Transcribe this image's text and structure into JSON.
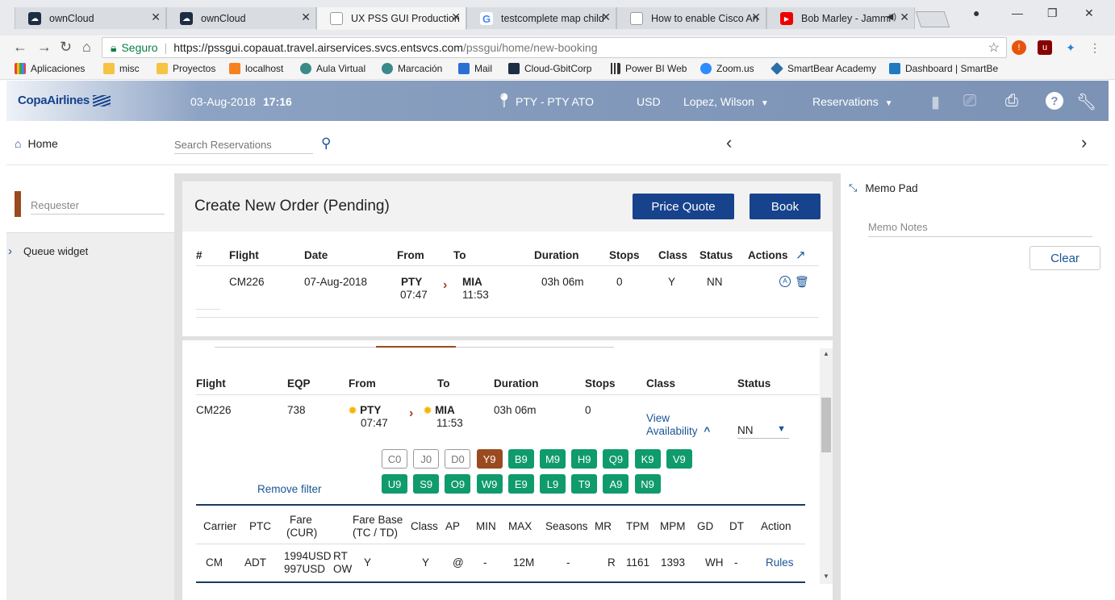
{
  "browser": {
    "tabs": [
      {
        "title": "ownCloud"
      },
      {
        "title": "ownCloud"
      },
      {
        "title": "UX PSS GUI Production"
      },
      {
        "title": "testcomplete map child"
      },
      {
        "title": "How to enable Cisco An"
      },
      {
        "title": "Bob Marley - Jammi"
      }
    ],
    "security_label": "Seguro",
    "url_host": "https://pssgui.copauat.travel.airservices.svcs.entsvcs.com",
    "url_path": "/pssgui/home/new-booking",
    "bookmarks": [
      "Aplicaciones",
      "misc",
      "Proyectos",
      "localhost",
      "Aula Virtual",
      "Marcación",
      "Mail",
      "Cloud-GbitCorp",
      "Power BI Web",
      "Zoom.us",
      "SmartBear Academy",
      "Dashboard | SmartBe"
    ]
  },
  "header": {
    "logo": "CopaAirlines",
    "date": "03-Aug-2018",
    "time": "17:16",
    "location": "PTY - PTY ATO",
    "currency": "USD",
    "user": "Lopez, Wilson",
    "menu": "Reservations"
  },
  "subheader": {
    "home_label": "Home",
    "search_placeholder": "Search Reservations"
  },
  "left": {
    "requester_placeholder": "Requester",
    "queue_label": "Queue widget"
  },
  "order": {
    "title": "Create New Order (Pending)",
    "price_quote": "Price Quote",
    "book": "Book",
    "columns": [
      "#",
      "Flight",
      "Date",
      "From",
      "To",
      "Duration",
      "Stops",
      "Class",
      "Status",
      "Actions"
    ],
    "row": {
      "flight": "CM226",
      "date": "07-Aug-2018",
      "from_code": "PTY",
      "from_time": "07:47",
      "to_code": "MIA",
      "to_time": "11:53",
      "duration": "03h 06m",
      "stops": "0",
      "class": "Y",
      "status": "NN"
    }
  },
  "segment": {
    "columns": [
      "Flight",
      "EQP",
      "From",
      "To",
      "Duration",
      "Stops",
      "Class",
      "Status"
    ],
    "row": {
      "flight": "CM226",
      "eqp": "738",
      "from_code": "PTY",
      "from_time": "07:47",
      "to_code": "MIA",
      "to_time": "11:53",
      "duration": "03h 06m",
      "stops": "0",
      "view_avail_1": "View",
      "view_avail_2": "Availability",
      "status": "NN"
    },
    "classes_row1": [
      "C0",
      "J0",
      "D0",
      "Y9",
      "B9",
      "M9",
      "H9",
      "Q9",
      "K9",
      "V9"
    ],
    "classes_row2": [
      "U9",
      "S9",
      "O9",
      "W9",
      "E9",
      "L9",
      "T9",
      "A9",
      "N9"
    ],
    "remove_filter": "Remove filter",
    "fare_columns": {
      "carrier": "Carrier",
      "ptc": "PTC",
      "fare": "Fare",
      "fare_cur": "(CUR)",
      "farebase": "Fare Base",
      "farebase_sub": "(TC / TD)",
      "class": "Class",
      "ap": "AP",
      "min": "MIN",
      "max": "MAX",
      "seasons": "Seasons",
      "mr": "MR",
      "tpm": "TPM",
      "mpm": "MPM",
      "gd": "GD",
      "dt": "DT",
      "action": "Action"
    },
    "fare_row": {
      "carrier": "CM",
      "ptc": "ADT",
      "fare1": "1994USD",
      "fare1_type": "RT",
      "fare2": "997USD",
      "fare2_type": "OW",
      "farebase": "Y",
      "class": "Y",
      "ap": "@",
      "min": "-",
      "max": "12M",
      "seasons": "-",
      "mr": "R",
      "tpm": "1161",
      "mpm": "1393",
      "gd": "WH",
      "dt": "-",
      "action": "Rules"
    }
  },
  "memo": {
    "title": "Memo Pad",
    "placeholder": "Memo Notes",
    "clear": "Clear"
  },
  "colors": {
    "brand_blue": "#17428c",
    "accent_brown": "#9a4a1f",
    "available_green": "#0f9b6b"
  }
}
